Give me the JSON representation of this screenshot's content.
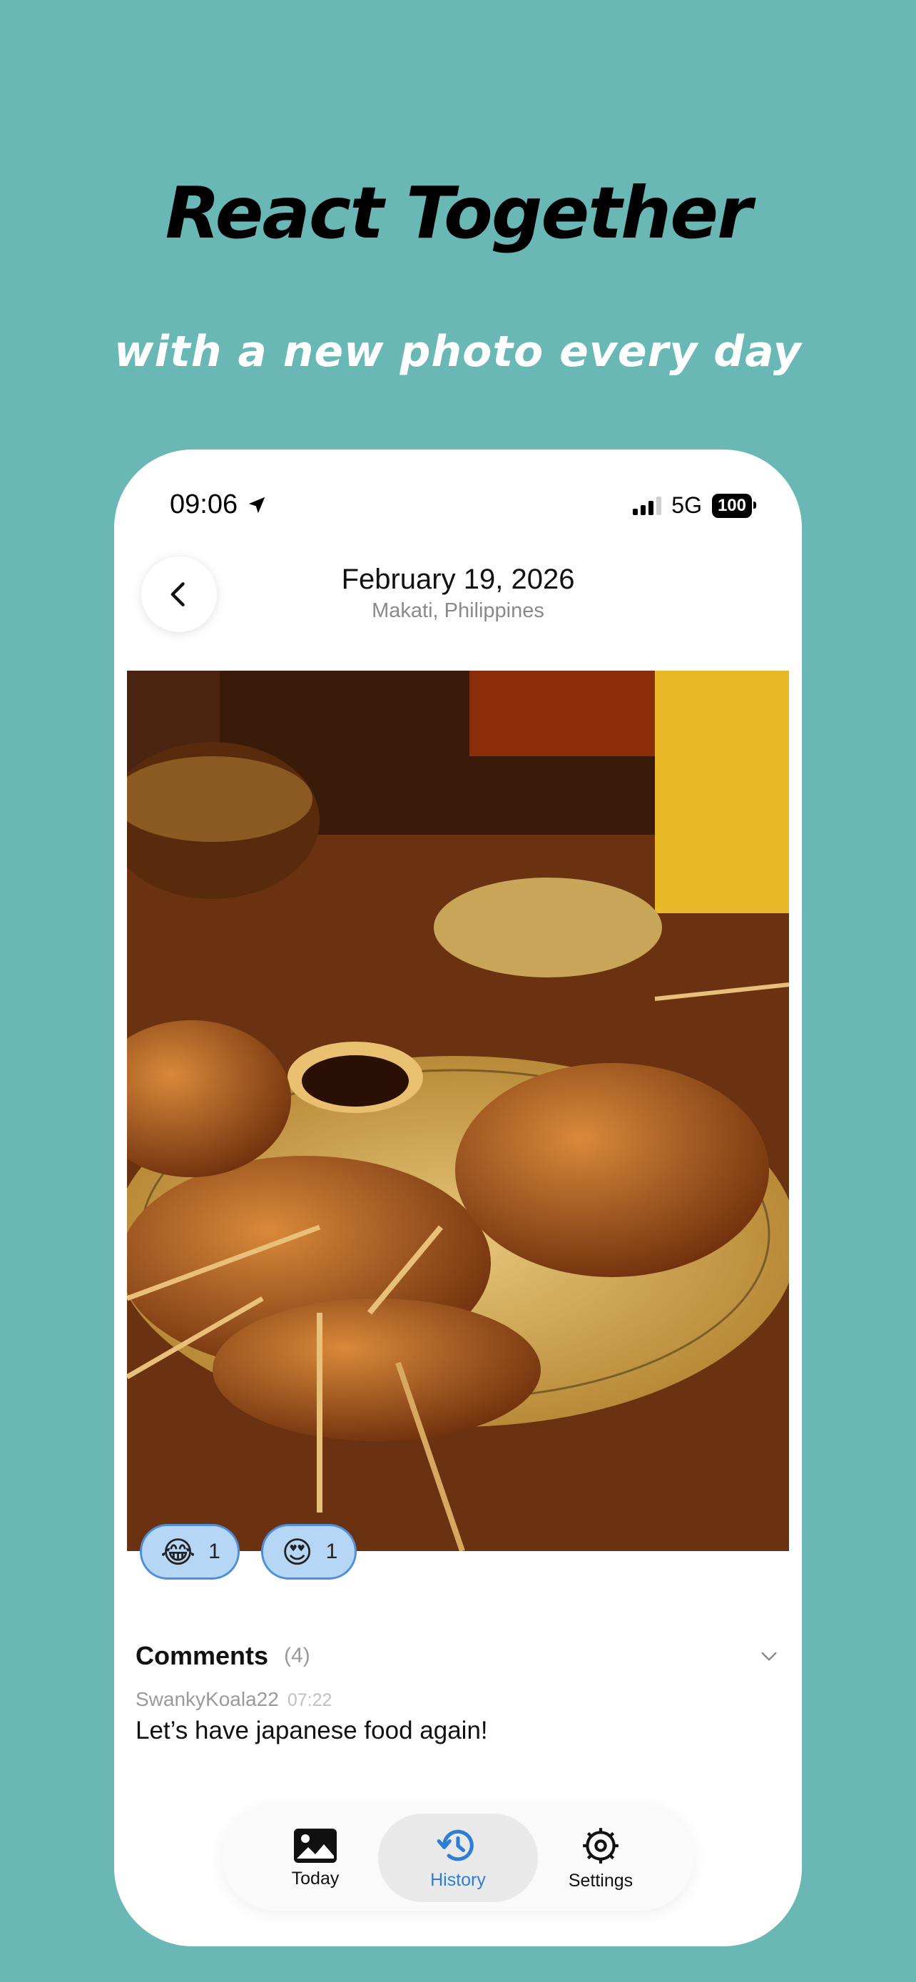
{
  "promo": {
    "headline": "React Together",
    "subline": "with a new photo every day"
  },
  "status_bar": {
    "time": "09:06",
    "network": "5G",
    "battery": "100"
  },
  "header": {
    "date": "February 19, 2026",
    "location": "Makati, Philippines"
  },
  "photo": {
    "description_icon": "photo"
  },
  "reactions": [
    {
      "emoji": "😂",
      "count": "1"
    },
    {
      "emoji": "😍",
      "count": "1"
    }
  ],
  "comments": {
    "title": "Comments",
    "count": "(4)",
    "items": [
      {
        "author": "SwankyKoala22",
        "time": "07:22",
        "text": "Let’s have japanese food again!"
      }
    ]
  },
  "tabbar": {
    "items": [
      {
        "label": "Today",
        "icon": "photo-icon"
      },
      {
        "label": "History",
        "icon": "history-icon",
        "active": true
      },
      {
        "label": "Settings",
        "icon": "gear-icon"
      }
    ]
  },
  "colors": {
    "background": "#69b8b6",
    "accent": "#2e7ed8",
    "reaction_fill": "#b6d6f6",
    "reaction_border": "#4d8fdc"
  }
}
